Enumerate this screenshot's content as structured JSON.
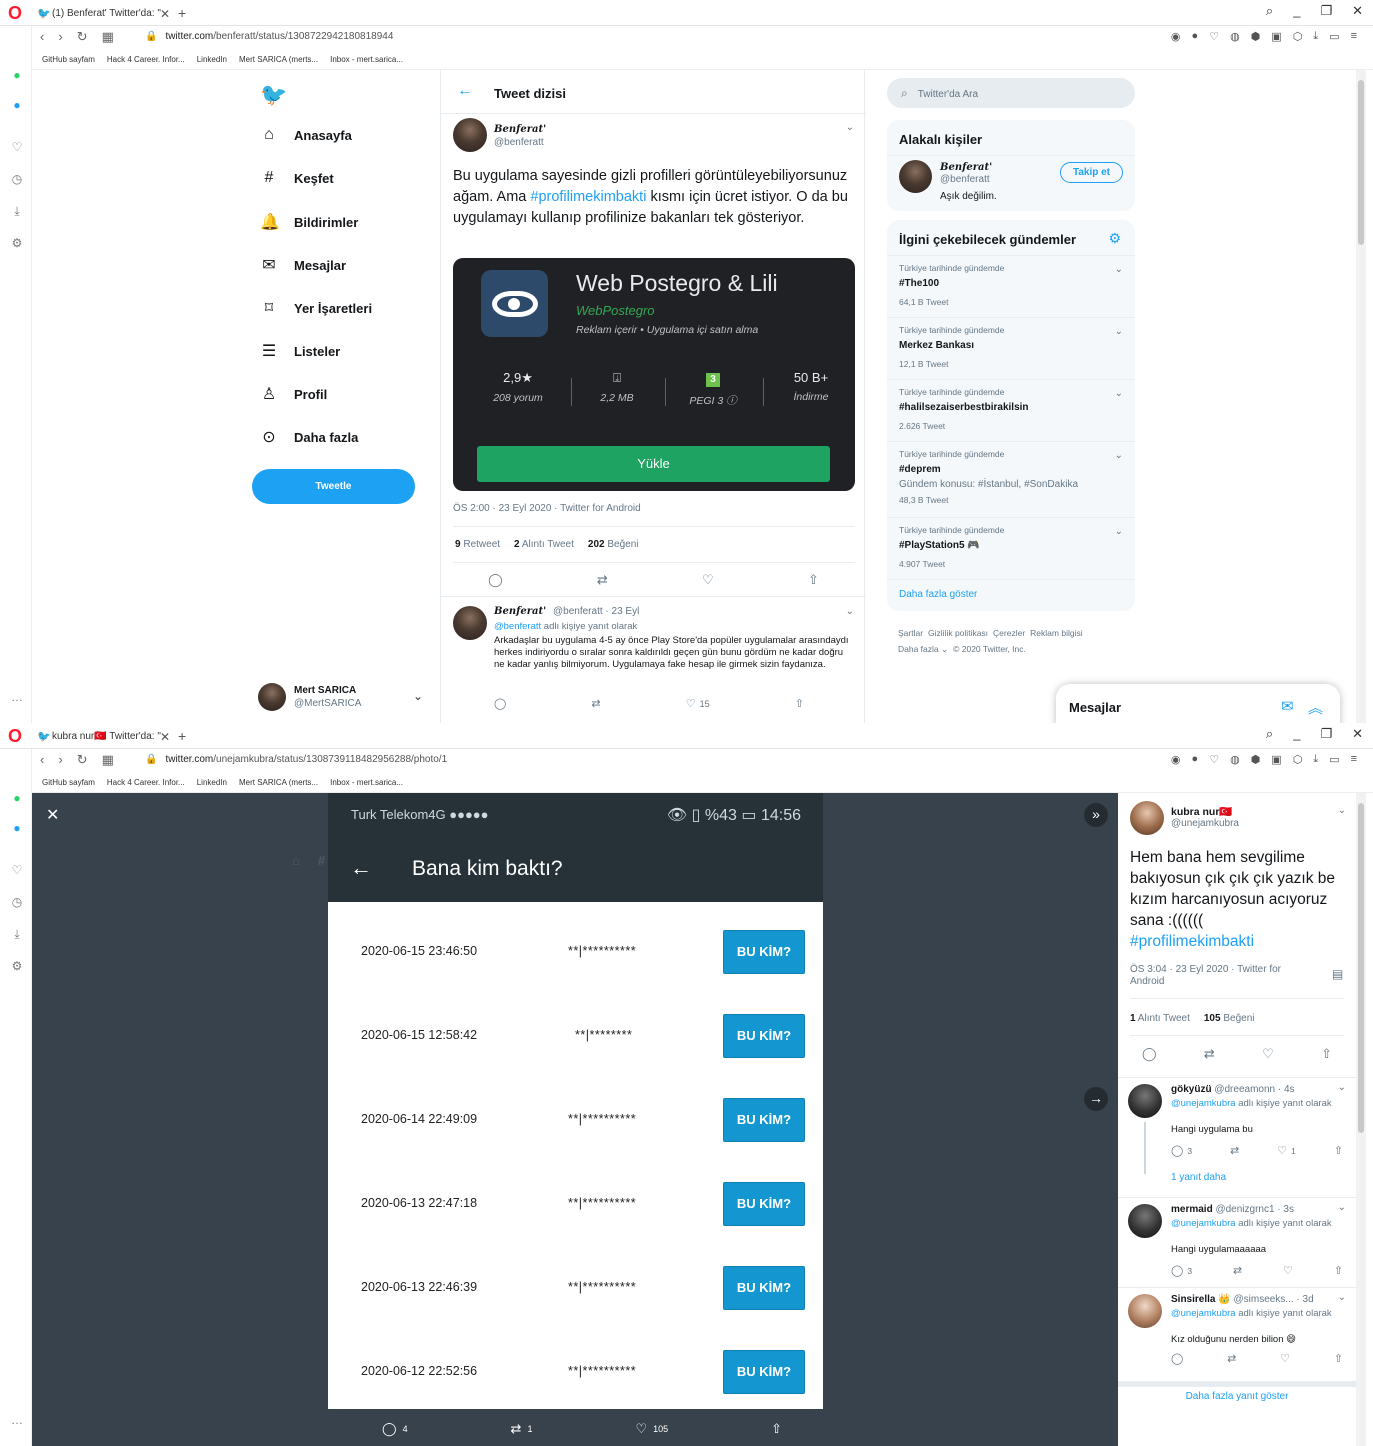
{
  "window1": {
    "tab_title": "(1) Benferat' Twitter'da: \"",
    "url_host": "twitter.com",
    "url_path": "/benferatt/status/1308722942180818944",
    "bookmarks": [
      "GitHub sayfam",
      "Hack 4 Career. Infor...",
      "LinkedIn",
      "Mert SARICA (merts...",
      "Inbox - mert.sarica..."
    ],
    "nav": {
      "home": "Anasayfa",
      "explore": "Keşfet",
      "notifications": "Bildirimler",
      "messages": "Mesajlar",
      "bookmarks": "Yer İşaretleri",
      "lists": "Listeler",
      "profile": "Profil",
      "more": "Daha fazla",
      "tweet_button": "Tweetle",
      "notif_badge": "1"
    },
    "account": {
      "name": "Mert SARICA",
      "handle": "@MertSARICA"
    },
    "header_title": "Tweet dizisi",
    "main_tweet": {
      "name": "Benferat'",
      "handle": "@benferatt",
      "text_1": "Bu uygulama sayesinde gizli profilleri görüntüleyebiliyorsunuz ağam. Ama ",
      "hashtag": "#profilimekimbakti",
      "text_2": " kısmı için ücret istiyor. O da bu uygulamayı kullanıp profilinize bakanları tek gösteriyor.",
      "meta": "ÖS 2:00 · 23 Eyl 2020 · Twitter for Android",
      "retweets_num": "9",
      "retweets_label": "Retweet",
      "quotes_num": "2",
      "quotes_label": "Alıntı Tweet",
      "likes_num": "202",
      "likes_label": "Beğeni"
    },
    "app_card": {
      "name": "Web Postegro & Lili",
      "developer": "WebPostegro",
      "info": "Reklam içerir • Uygulama içi satın alma",
      "rating": "2,9★",
      "reviews": "208 yorum",
      "size": "2,2 MB",
      "pegi_badge": "3",
      "pegi": "PEGI 3 ⓘ",
      "installs": "50 B+",
      "installs_label": "İndirme",
      "install_button": "Yükle"
    },
    "reply": {
      "name": "Benferat'",
      "meta": "@benferatt · 23 Eyl",
      "reply_to_handle": "@benferatt",
      "reply_to_suffix": " adlı kişiye yanıt olarak",
      "text": "Arkadaşlar bu uygulama 4-5 ay önce Play Store'da popüler uygulamalar arasındaydı herkes indiriyordu o sıralar sonra kaldırıldı geçen gün bunu gördüm ne kadar doğru ne kadar yanlış bilmiyorum. Uygulamaya fake hesap ile girmek sizin faydanıza.",
      "likes": "15"
    },
    "search_placeholder": "Twitter'da Ara",
    "related": {
      "title": "Alakalı kişiler",
      "name": "Benferat'",
      "handle": "@benferatt",
      "bio": "Aşık değilim.",
      "follow": "Takip et"
    },
    "trends": {
      "title": "İlgini çekebilecek gündemler",
      "items": [
        {
          "context": "Türkiye tarihinde gündemde",
          "name": "#The100",
          "sub": "",
          "count": "64,1 B Tweet"
        },
        {
          "context": "Türkiye tarihinde gündemde",
          "name": "Merkez Bankası",
          "sub": "",
          "count": "12,1 B Tweet"
        },
        {
          "context": "Türkiye tarihinde gündemde",
          "name": "#halilsezaiserbestbirakilsin",
          "sub": "",
          "count": "2.626 Tweet"
        },
        {
          "context": "Türkiye tarihinde gündemde",
          "name": "#deprem",
          "sub": "Gündem konusu: #İstanbul, #SonDakika",
          "count": "48,3 B Tweet"
        },
        {
          "context": "Türkiye tarihinde gündemde",
          "name": "#PlayStation5 🎮",
          "sub": "",
          "count": "4.907 Tweet"
        }
      ],
      "show_more": "Daha fazla göster"
    },
    "footer": {
      "links": [
        "Şartlar",
        "Gizlilik politikası",
        "Çerezler",
        "Reklam bilgisi"
      ],
      "more": "Daha fazla ⌄",
      "copyright": "© 2020 Twitter, Inc."
    },
    "messages_drawer": "Mesajlar"
  },
  "window2": {
    "tab_title": "kubra nur🇹🇷 Twitter'da: \"",
    "url_host": "twitter.com",
    "url_path": "/unejamkubra/status/1308739118482956288/photo/1",
    "phone": {
      "carrier": "Turk Telekom4G ●●●●●",
      "status_right": "👁 ▯ %43 ▭ 14:56",
      "title": "Bana kim baktı?",
      "rows": [
        {
          "date": "2020-06-15 23:46:50",
          "masked": "**|**********",
          "button": "BU KİM?"
        },
        {
          "date": "2020-06-15 12:58:42",
          "masked": "**|********",
          "button": "BU KİM?"
        },
        {
          "date": "2020-06-14 22:49:09",
          "masked": "**|**********",
          "button": "BU KİM?"
        },
        {
          "date": "2020-06-13 22:47:18",
          "masked": "**|**********",
          "button": "BU KİM?"
        },
        {
          "date": "2020-06-13 22:46:39",
          "masked": "**|**********",
          "button": "BU KİM?"
        },
        {
          "date": "2020-06-12 22:52:56",
          "masked": "**|**********",
          "button": "BU KİM?"
        }
      ]
    },
    "overlay_actions": {
      "replies": "4",
      "retweets": "1",
      "likes": "105"
    },
    "detail": {
      "name": "kubra nur🇹🇷",
      "handle": "@unejamkubra",
      "text": "Hem bana hem sevgilime bakıyosun çık çık çık yazık be kızım harcanıyosun acıyoruz sana :((((((",
      "hashtag": "#profilimekimbakti",
      "meta": "ÖS 3:04 · 23 Eyl 2020 · Twitter for Android",
      "quotes_num": "1",
      "quotes_label": "Alıntı Tweet",
      "likes_num": "105",
      "likes_label": "Beğeni"
    },
    "replies": [
      {
        "name": "gökyüzü",
        "meta": "@dreeamonn · 4s",
        "to": "@unejamkubra",
        "to_suffix": " adlı kişiye yanıt olarak",
        "text": "Hangi uygulama bu",
        "replies": "3",
        "likes": "1",
        "more": "1 yanıt daha"
      },
      {
        "name": "mermaid",
        "meta": "@denizgrnc1 · 3s",
        "to": "@unejamkubra",
        "to_suffix": " adlı kişiye yanıt olarak",
        "text": "Hangi uygulamaaaaaa",
        "replies": "3",
        "likes": "",
        "more": ""
      },
      {
        "name": "Sinsirella 👑",
        "meta": "@simseeks... · 3d",
        "to": "@unejamkubra",
        "to_suffix": " adlı kişiye yanıt olarak",
        "text": "Kız olduğunu nerden bilion 😄",
        "replies": "",
        "likes": "",
        "more": ""
      }
    ],
    "show_more_replies": "Daha fazla yanıt göster"
  }
}
